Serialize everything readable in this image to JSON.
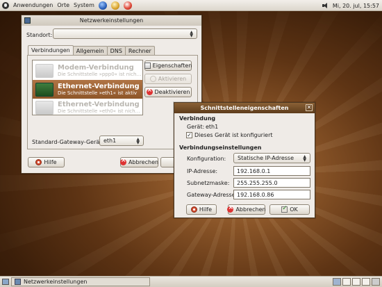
{
  "top_panel": {
    "menus": [
      "Anwendungen",
      "Orte",
      "System"
    ],
    "clock": "Mi, 20. jul, 15:57"
  },
  "main_window": {
    "title": "Netzwerkeinstellungen",
    "location_label": "Standort:",
    "location_value": "",
    "tabs": [
      "Verbindungen",
      "Allgemein",
      "DNS",
      "Rechner"
    ],
    "connections": [
      {
        "title": "Modem-Verbindung",
        "subtitle": "Die Schnittstelle »ppp0« ist nich…",
        "state": "disabled"
      },
      {
        "title": "Ethernet-Verbindung",
        "subtitle": "Die Schnittstelle »eth1« ist aktiv",
        "state": "selected"
      },
      {
        "title": "Ethernet-Verbindung",
        "subtitle": "Die Schnittstelle »eth0« ist nich…",
        "state": "disabled"
      }
    ],
    "buttons": {
      "properties": "Eigenschaften",
      "activate": "Aktivieren",
      "deactivate": "Deaktivieren",
      "help": "Hilfe",
      "cancel": "Abbrechen"
    },
    "gateway_label": "Standard-Gateway-Gerät:",
    "gateway_value": "eth1"
  },
  "dialog": {
    "title": "Schnittstelleneigenschaften",
    "section_connection": "Verbindung",
    "device_label": "Gerät:",
    "device_value": "eth1",
    "configured_label": "Dieses Gerät ist konfiguriert",
    "configured_checked": true,
    "section_settings": "Verbindungseinstellungen",
    "config_label": "Konfiguration:",
    "config_value": "Statische IP-Adresse",
    "ip_label": "IP-Adresse:",
    "ip_value": "192.168.0.1",
    "subnet_label": "Subnetzmaske:",
    "subnet_value": "255.255.255.0",
    "gateway_label": "Gateway-Adresse:",
    "gateway_value": "192.168.0.86",
    "buttons": {
      "help": "Hilfe",
      "cancel": "Abbrechen",
      "ok": "OK"
    }
  },
  "bottom_panel": {
    "taskbar_item": "Netzwerkeinstellungen"
  }
}
